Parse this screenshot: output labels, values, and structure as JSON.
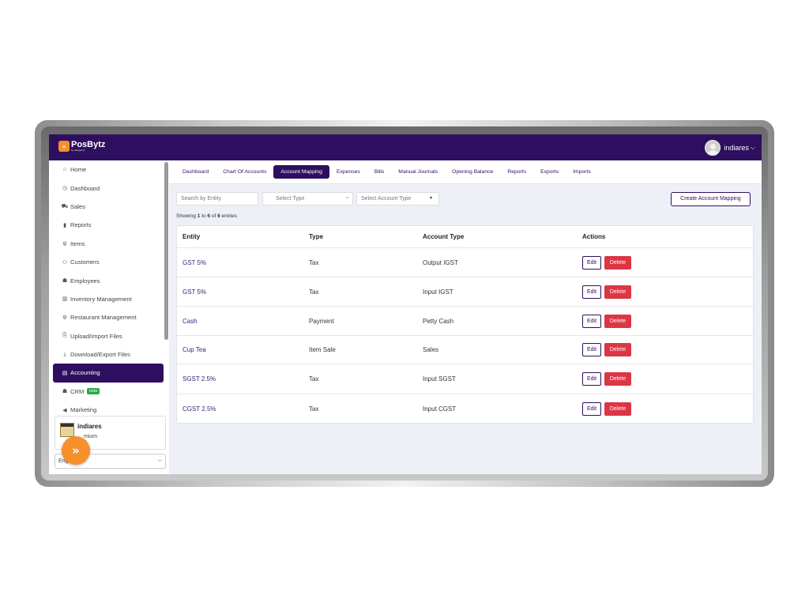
{
  "app": {
    "brand": "PosBytz",
    "brand_sub": "by datagenie",
    "user_name": "indiares"
  },
  "sidebar": {
    "items": [
      {
        "label": "Home",
        "icon": "home-icon"
      },
      {
        "label": "Dashboard",
        "icon": "dashboard-icon"
      },
      {
        "label": "Sales",
        "icon": "cart-icon"
      },
      {
        "label": "Reports",
        "icon": "chart-icon"
      },
      {
        "label": "Items",
        "icon": "items-icon"
      },
      {
        "label": "Customers",
        "icon": "customers-icon"
      },
      {
        "label": "Employees",
        "icon": "employees-icon"
      },
      {
        "label": "Inventory Management",
        "icon": "inventory-icon"
      },
      {
        "label": "Restaurant Management",
        "icon": "restaurant-icon"
      },
      {
        "label": "Upload/Import Files",
        "icon": "upload-icon"
      },
      {
        "label": "Download/Export Files",
        "icon": "download-icon"
      },
      {
        "label": "Accounting",
        "icon": "accounting-icon",
        "active": true
      },
      {
        "label": "CRM",
        "icon": "crm-icon",
        "badge": "beta"
      },
      {
        "label": "Marketing",
        "icon": "marketing-icon"
      }
    ],
    "user_card": {
      "name": "indiares",
      "plan": "mium"
    },
    "language": "Engl"
  },
  "tabs": [
    {
      "label": "Dashboard"
    },
    {
      "label": "Chart Of Accounts"
    },
    {
      "label": "Account Mapping",
      "active": true
    },
    {
      "label": "Expenses"
    },
    {
      "label": "Bills"
    },
    {
      "label": "Manual Journals"
    },
    {
      "label": "Opening Balance"
    },
    {
      "label": "Reports"
    },
    {
      "label": "Exports"
    },
    {
      "label": "Imports"
    }
  ],
  "filters": {
    "search_placeholder": "Search by Entity",
    "type_placeholder": "Select Type",
    "account_type_placeholder": "Select Account Type",
    "create_label": "Create Account Mapping"
  },
  "showing": {
    "prefix": "Showing",
    "from": "1",
    "to_word": "to",
    "to": "6",
    "of_word": "of",
    "total": "6",
    "suffix": "entries"
  },
  "table": {
    "headers": [
      "Entity",
      "Type",
      "Account Type",
      "Actions"
    ],
    "rows": [
      {
        "entity": "GST 5%",
        "type": "Tax",
        "account_type": "Output IGST"
      },
      {
        "entity": "GST 5%",
        "type": "Tax",
        "account_type": "Input IGST"
      },
      {
        "entity": "Cash",
        "type": "Payment",
        "account_type": "Petty Cash"
      },
      {
        "entity": "Cup Tea",
        "type": "Item Sale",
        "account_type": "Sales"
      },
      {
        "entity": "SGST 2.5%",
        "type": "Tax",
        "account_type": "Input SGST"
      },
      {
        "entity": "CGST 2.5%",
        "type": "Tax",
        "account_type": "Input CGST"
      }
    ],
    "edit_label": "Edit",
    "delete_label": "Delete"
  },
  "colors": {
    "brand": "#2e0f5f",
    "accent": "#f78f2b",
    "danger": "#dc3545"
  }
}
